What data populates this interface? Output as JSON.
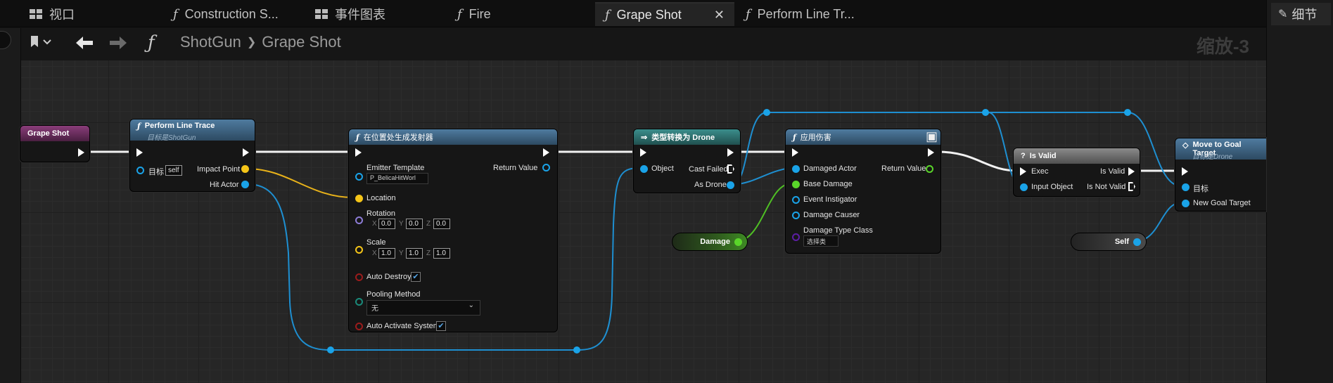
{
  "tabs": [
    {
      "label": "视口"
    },
    {
      "label": "Construction S..."
    },
    {
      "label": "事件图表"
    },
    {
      "label": "Fire"
    },
    {
      "label": "Grape Shot"
    },
    {
      "label": "Perform Line Tr..."
    }
  ],
  "right_panel": {
    "title": "细节"
  },
  "toolbar": {
    "breadcrumb_parent": "ShotGun",
    "breadcrumb_sep": "❯",
    "breadcrumb_current": "Grape Shot",
    "zoom": "缩放-3"
  },
  "nodes": {
    "entry": {
      "title": "Grape Shot"
    },
    "line_trace": {
      "title": "Perform Line Trace",
      "subtitle": "目标是ShotGun",
      "target_label": "目标",
      "target_value": "self",
      "out1": "Impact Point",
      "out2": "Hit Actor"
    },
    "spawn": {
      "title": "在位置处生成发射器",
      "emitter": "Emitter Template",
      "emitter_value": "P_BelicaHitWorl",
      "return": "Return Value",
      "location": "Location",
      "rotation": "Rotation",
      "rot_x": "0.0",
      "rot_y": "0.0",
      "rot_z": "0.0",
      "scale": "Scale",
      "sc_x": "1.0",
      "sc_y": "1.0",
      "sc_z": "1.0",
      "auto_destroy": "Auto Destroy",
      "pooling": "Pooling Method",
      "pooling_value": "无",
      "auto_activate": "Auto Activate System",
      "x": "X",
      "y": "Y",
      "z": "Z"
    },
    "cast": {
      "title": "类型转换为 Drone",
      "object": "Object",
      "cast_failed": "Cast Failed",
      "as_drone": "As Drone"
    },
    "damage": {
      "title": "应用伤害",
      "damaged_actor": "Damaged Actor",
      "return": "Return Value",
      "base_damage": "Base Damage",
      "instigator": "Event Instigator",
      "causer": "Damage Causer",
      "type_class": "Damage Type Class",
      "type_value": "选择类"
    },
    "is_valid": {
      "title": "Is Valid",
      "exec": "Exec",
      "input": "Input Object",
      "valid": "Is Valid",
      "not_valid": "Is Not Valid"
    },
    "move": {
      "title": "Move to Goal Target",
      "subtitle": "目标是Drone",
      "target": "目标",
      "goal": "New Goal Target"
    },
    "var_damage": {
      "label": "Damage"
    },
    "var_self": {
      "label": "Self"
    }
  },
  "colors": {
    "object_pin": "#1aa3e8",
    "vector_pin": "#f5c518",
    "float_pin": "#5ad52a",
    "class_pin": "#5c1ea3",
    "bool_pin": "#9b1c1c",
    "struct_pin": "#1a8a7a",
    "exec": "#ffffff"
  }
}
